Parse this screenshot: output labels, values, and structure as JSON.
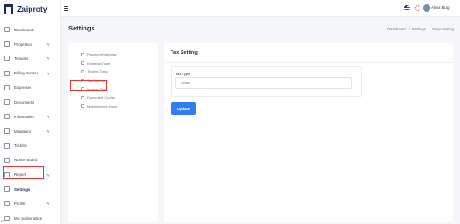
{
  "app": {
    "brand": "Zaiproty"
  },
  "sidebar": {
    "items": [
      {
        "label": "Dashboard",
        "icon": "dashboard-icon",
        "chevron": false
      },
      {
        "label": "Properties",
        "icon": "building-icon",
        "chevron": true
      },
      {
        "label": "Tenants",
        "icon": "users-icon",
        "chevron": true
      },
      {
        "label": "Billing Center",
        "icon": "billing-icon",
        "chevron": true
      },
      {
        "label": "Expenses",
        "icon": "expenses-icon",
        "chevron": false
      },
      {
        "label": "Documents",
        "icon": "documents-icon",
        "chevron": false
      },
      {
        "label": "Information",
        "icon": "info-icon",
        "chevron": true
      },
      {
        "label": "Maintains",
        "icon": "tools-icon",
        "chevron": true
      },
      {
        "label": "Tickets",
        "icon": "ticket-icon",
        "chevron": false
      },
      {
        "label": "Notice Board",
        "icon": "notice-icon",
        "chevron": false
      },
      {
        "label": "Report",
        "icon": "report-icon",
        "chevron": true
      },
      {
        "label": "Settings",
        "icon": "gear-icon",
        "chevron": false
      },
      {
        "label": "Profile",
        "icon": "profile-icon",
        "chevron": true
      },
      {
        "label": "My Subscription",
        "icon": "subscription-icon",
        "chevron": false
      }
    ]
  },
  "topbar": {
    "user_name": "Alexa Burg"
  },
  "header": {
    "title": "Settings",
    "breadcrumb": [
      "Dashboard",
      "Settings",
      "Smtp Setting"
    ]
  },
  "settings_menu": {
    "items": [
      "Payment Gateway",
      "Expense Type",
      "Tickets Topic",
      "Tax Setting",
      "Invoice Type",
      "Document Config",
      "Maintenance Issue"
    ]
  },
  "content": {
    "title": "Tax Setting",
    "field_label": "Tax Type",
    "field_value": "Vatio",
    "update_label": "Update"
  }
}
